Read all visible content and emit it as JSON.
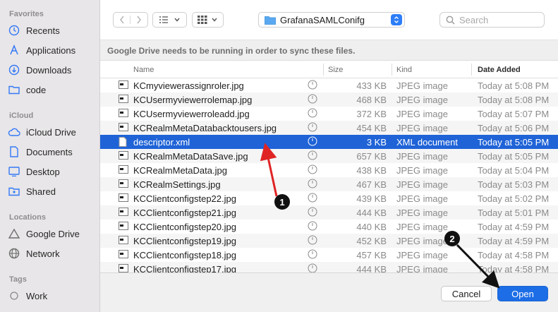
{
  "sidebar": {
    "favorites_heading": "Favorites",
    "favorites": [
      {
        "label": "Recents",
        "icon": "clock-icon"
      },
      {
        "label": "Applications",
        "icon": "applications-icon"
      },
      {
        "label": "Downloads",
        "icon": "download-icon"
      },
      {
        "label": "code",
        "icon": "folder-icon"
      }
    ],
    "icloud_heading": "iCloud",
    "icloud": [
      {
        "label": "iCloud Drive",
        "icon": "cloud-icon"
      },
      {
        "label": "Documents",
        "icon": "document-icon"
      },
      {
        "label": "Desktop",
        "icon": "desktop-icon"
      },
      {
        "label": "Shared",
        "icon": "shared-folder-icon"
      }
    ],
    "locations_heading": "Locations",
    "locations": [
      {
        "label": "Google Drive",
        "icon": "drive-icon"
      },
      {
        "label": "Network",
        "icon": "globe-icon"
      }
    ],
    "tags_heading": "Tags",
    "tags": [
      {
        "label": "Work",
        "icon": "tag-dot-icon"
      }
    ]
  },
  "toolbar": {
    "current_folder": "GrafanaSAMLConifg",
    "search_placeholder": "Search"
  },
  "info_message": "Google Drive needs to be running in order to sync these files.",
  "columns": {
    "name": "Name",
    "size": "Size",
    "kind": "Kind",
    "date_added": "Date Added"
  },
  "files": [
    {
      "name": "KCmyviewerassignroler.jpg",
      "size": "433 KB",
      "kind": "JPEG image",
      "date": "Today at 5:08 PM"
    },
    {
      "name": "KCUsermyviewerrolemap.jpg",
      "size": "468 KB",
      "kind": "JPEG image",
      "date": "Today at 5:08 PM"
    },
    {
      "name": "KCUsermyviewerroleadd.jpg",
      "size": "372 KB",
      "kind": "JPEG image",
      "date": "Today at 5:07 PM"
    },
    {
      "name": "KCRealmMetaDatabacktousers.jpg",
      "size": "454 KB",
      "kind": "JPEG image",
      "date": "Today at 5:06 PM"
    },
    {
      "name": "descriptor.xml",
      "size": "3 KB",
      "kind": "XML document",
      "date": "Today at 5:05 PM",
      "selected": true
    },
    {
      "name": "KCRealmMetaDataSave.jpg",
      "size": "657 KB",
      "kind": "JPEG image",
      "date": "Today at 5:05 PM"
    },
    {
      "name": "KCRealmMetaData.jpg",
      "size": "438 KB",
      "kind": "JPEG image",
      "date": "Today at 5:04 PM"
    },
    {
      "name": "KCRealmSettings.jpg",
      "size": "467 KB",
      "kind": "JPEG image",
      "date": "Today at 5:03 PM"
    },
    {
      "name": "KCClientconfigstep22.jpg",
      "size": "439 KB",
      "kind": "JPEG image",
      "date": "Today at 5:02 PM"
    },
    {
      "name": "KCClientconfigstep21.jpg",
      "size": "444 KB",
      "kind": "JPEG image",
      "date": "Today at 5:01 PM"
    },
    {
      "name": "KCClientconfigstep20.jpg",
      "size": "440 KB",
      "kind": "JPEG image",
      "date": "Today at 4:59 PM"
    },
    {
      "name": "KCClientconfigstep19.jpg",
      "size": "452 KB",
      "kind": "JPEG image",
      "date": "Today at 4:59 PM"
    },
    {
      "name": "KCClientconfigstep18.jpg",
      "size": "457 KB",
      "kind": "JPEG image",
      "date": "Today at 4:58 PM"
    },
    {
      "name": "KCClientconfigstep17.jpg",
      "size": "444 KB",
      "kind": "JPEG image",
      "date": "Today at 4:58 PM"
    }
  ],
  "footer": {
    "cancel_label": "Cancel",
    "open_label": "Open"
  },
  "annotations": {
    "step1": "1",
    "step2": "2",
    "arrow_color": "#e02424",
    "arrow2_color": "#111111"
  },
  "colors": {
    "accent": "#1d6de6",
    "selection": "#1f63d7"
  }
}
